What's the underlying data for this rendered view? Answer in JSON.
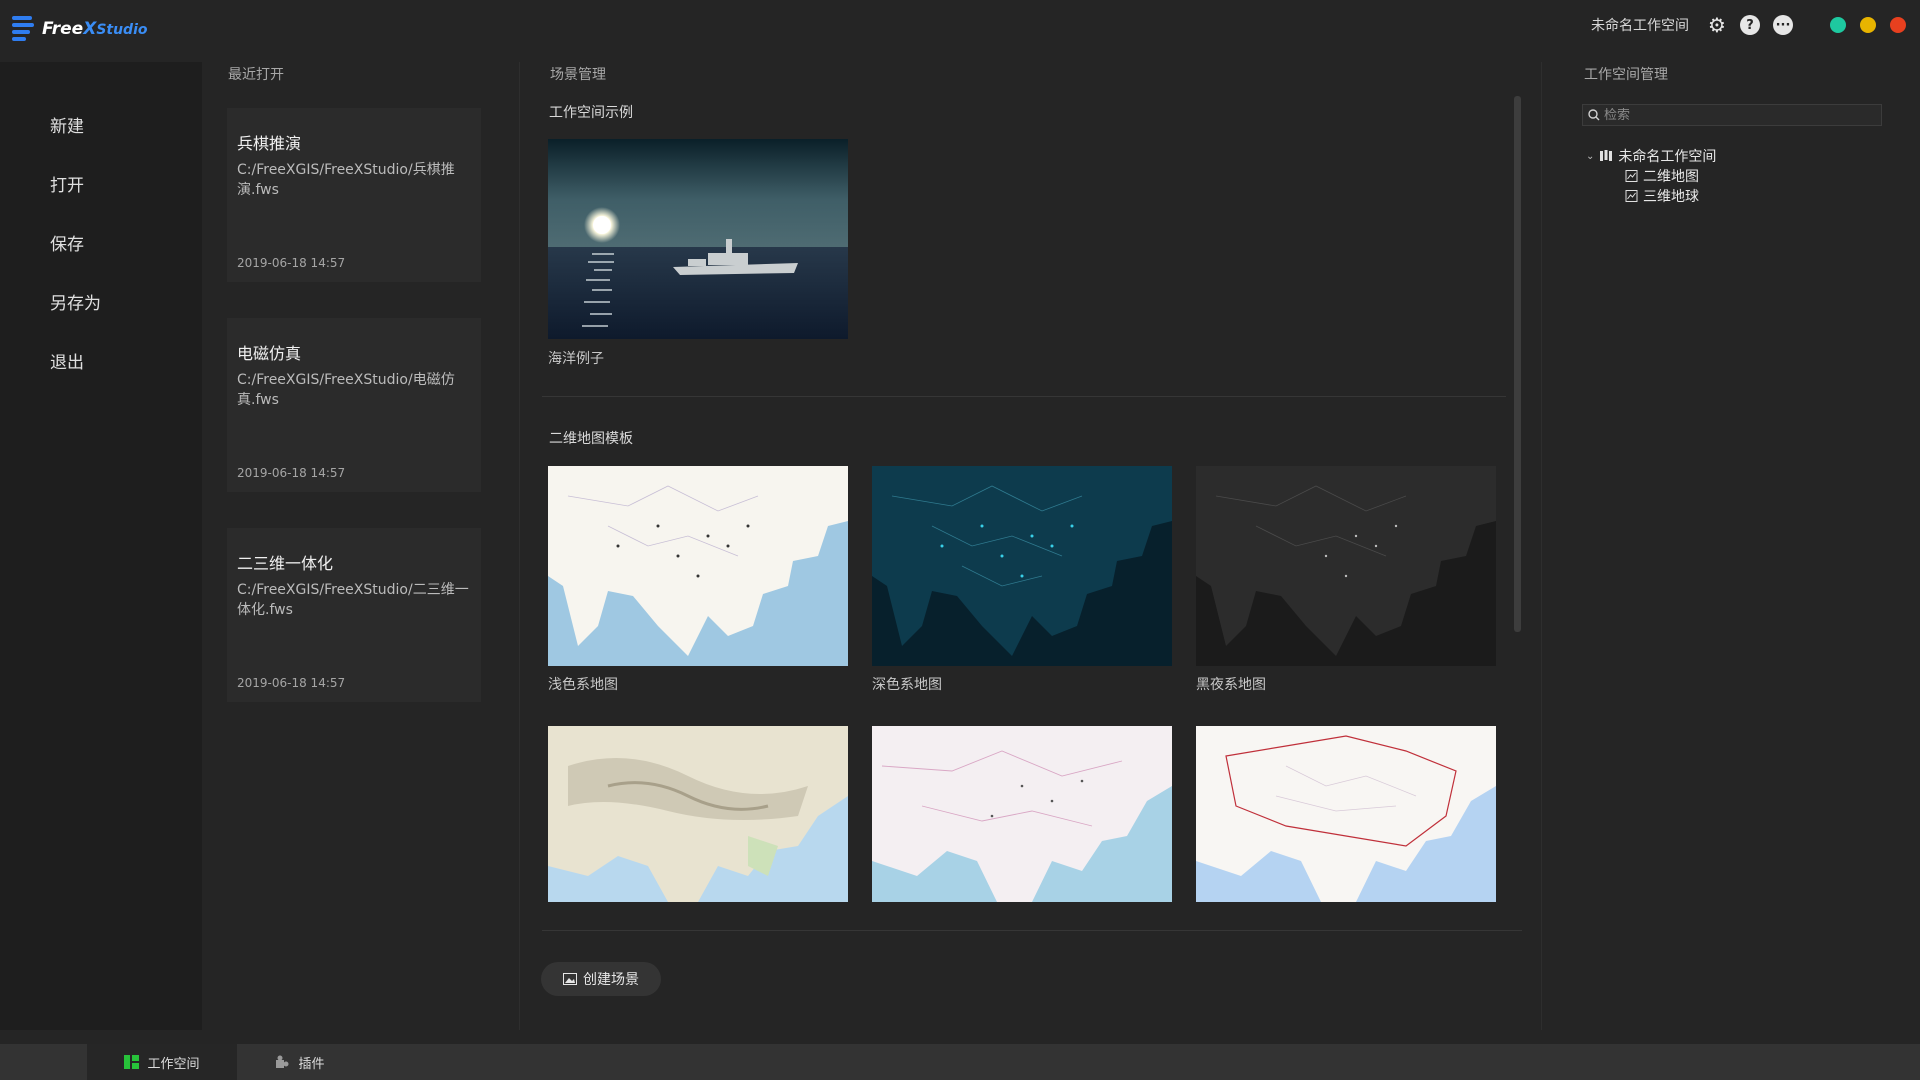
{
  "app": {
    "logo_free": "Free",
    "logo_x": "X",
    "logo_studio": "Studio"
  },
  "titlebar": {
    "workspace_name": "未命名工作空间",
    "icons": [
      "gear-icon",
      "help-icon",
      "chat-icon"
    ],
    "window_dots": [
      "#1ec9a0",
      "#e8b400",
      "#e8401f"
    ]
  },
  "menu": [
    "新建",
    "打开",
    "保存",
    "另存为",
    "退出"
  ],
  "recent": {
    "title": "最近打开",
    "items": [
      {
        "name": "兵棋推演",
        "path": "C:/FreeXGIS/FreeXStudio/兵棋推演.fws",
        "date": "2019-06-18 14:57"
      },
      {
        "name": "电磁仿真",
        "path": "C:/FreeXGIS/FreeXStudio/电磁仿真.fws",
        "date": "2019-06-18 14:57"
      },
      {
        "name": "二三维一体化",
        "path": "C:/FreeXGIS/FreeXStudio/二三维一体化.fws",
        "date": "2019-06-18 14:57"
      }
    ]
  },
  "scenes": {
    "title": "场景管理",
    "example_section": "工作空间示例",
    "example_items": [
      {
        "label": "海洋例子"
      }
    ],
    "template_section": "二维地图模板",
    "template_items": [
      {
        "label": "浅色系地图",
        "theme": "light"
      },
      {
        "label": "深色系地图",
        "theme": "dark"
      },
      {
        "label": "黑夜系地图",
        "theme": "night"
      },
      {
        "label": "",
        "theme": "terrain"
      },
      {
        "label": "",
        "theme": "pink"
      },
      {
        "label": "",
        "theme": "admin"
      }
    ],
    "create_button": "创建场景"
  },
  "workspace": {
    "title": "工作空间管理",
    "search_placeholder": "检索",
    "tree": {
      "root": "未命名工作空间",
      "children": [
        "二维地图",
        "三维地球"
      ]
    }
  },
  "bottom_tabs": [
    {
      "label": "工作空间",
      "icon": "workspace-icon",
      "active": true
    },
    {
      "label": "插件",
      "icon": "plugin-icon",
      "active": false
    }
  ]
}
